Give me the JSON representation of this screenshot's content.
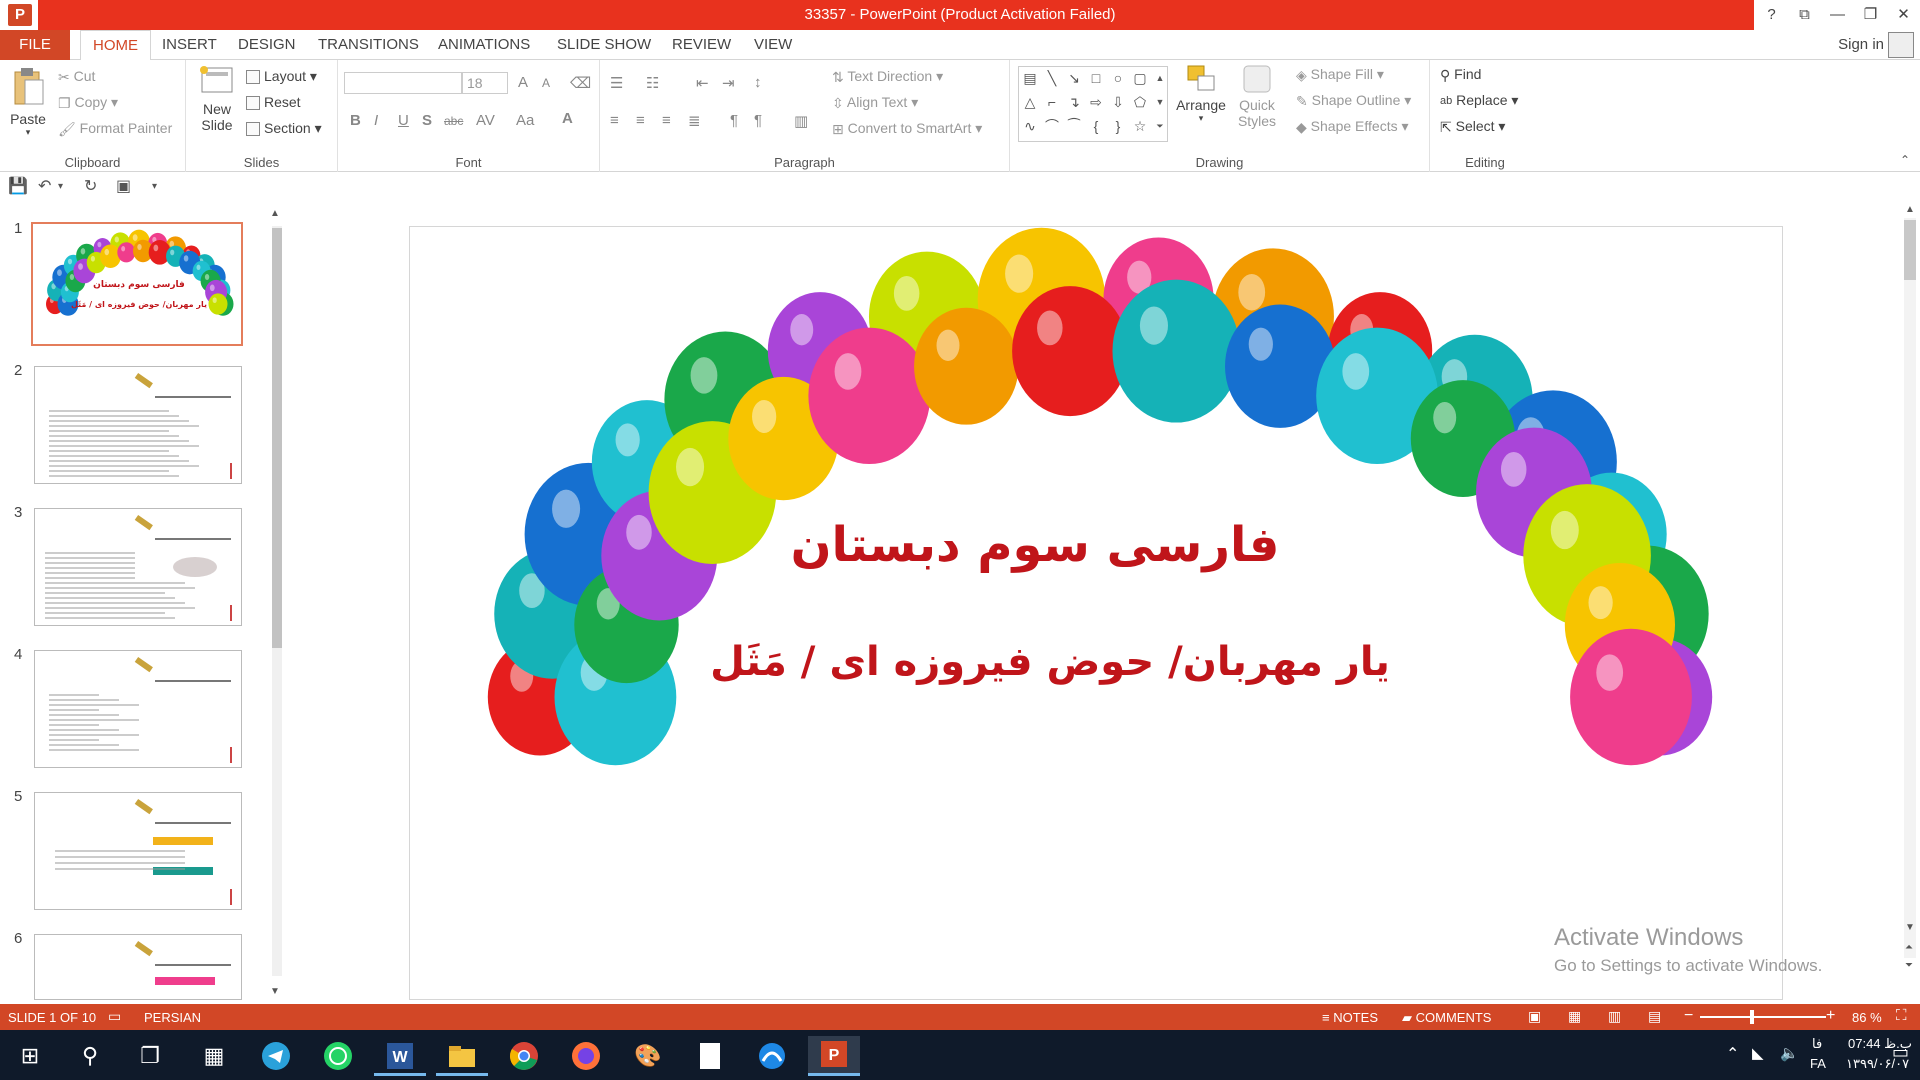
{
  "window": {
    "title": "33357  -  PowerPoint (Product Activation Failed)",
    "help": "?",
    "accent": "#d24726",
    "titlebar_red": "#e8321e"
  },
  "tabs": {
    "file": "FILE",
    "items": [
      "HOME",
      "INSERT",
      "DESIGN",
      "TRANSITIONS",
      "ANIMATIONS",
      "SLIDE SHOW",
      "REVIEW",
      "VIEW"
    ],
    "active": "HOME",
    "signin": "Sign in"
  },
  "ribbon": {
    "clipboard": {
      "label": "Clipboard",
      "paste": "Paste",
      "cut": "Cut",
      "copy": "Copy",
      "format_painter": "Format Painter"
    },
    "slides": {
      "label": "Slides",
      "new_slide_1": "New",
      "new_slide_2": "Slide",
      "layout": "Layout",
      "reset": "Reset",
      "section": "Section"
    },
    "font": {
      "label": "Font",
      "font_name": "",
      "font_size": "18",
      "grow": "A",
      "shrink": "A",
      "bold": "B",
      "italic": "I",
      "underline": "U",
      "shadow": "S",
      "strike": "abc",
      "spacing": "AV",
      "case": "Aa",
      "color": "A"
    },
    "paragraph": {
      "label": "Paragraph",
      "text_direction": "Text Direction",
      "align_text": "Align Text",
      "convert_smartart": "Convert to SmartArt"
    },
    "drawing": {
      "label": "Drawing",
      "arrange": "Arrange",
      "quick_styles_1": "Quick",
      "quick_styles_2": "Styles",
      "shape_fill": "Shape Fill",
      "shape_outline": "Shape Outline",
      "shape_effects": "Shape Effects"
    },
    "editing": {
      "label": "Editing",
      "find": "Find",
      "replace": "Replace",
      "select": "Select"
    }
  },
  "thumbnails": {
    "numbers": [
      "1",
      "2",
      "3",
      "4",
      "5",
      "6"
    ],
    "slide1_title": "فارسی سوم دبستان",
    "slide1_sub": "یار مهربان/ حوض فیروزه ای / مَثَل"
  },
  "slide": {
    "title": "فارسی سوم دبستان",
    "subtitle": "یار مهربان/ حوض فیروزه ای / مَثَل",
    "text_color": "#c0151a"
  },
  "watermark": {
    "line1": "Activate Windows",
    "line2": "Go to Settings to activate Windows."
  },
  "status": {
    "slide_of": "SLIDE 1 OF 10",
    "language": "PERSIAN",
    "notes": "NOTES",
    "comments": "COMMENTS",
    "zoom": "86 %",
    "zoom_minus": "−",
    "zoom_plus": "+"
  },
  "taskbar": {
    "time": "07:44 ب.ظ",
    "date": "۱۳۹۹/۰۶/۰۷",
    "lang_top": "فا",
    "lang_bottom": "FA"
  }
}
